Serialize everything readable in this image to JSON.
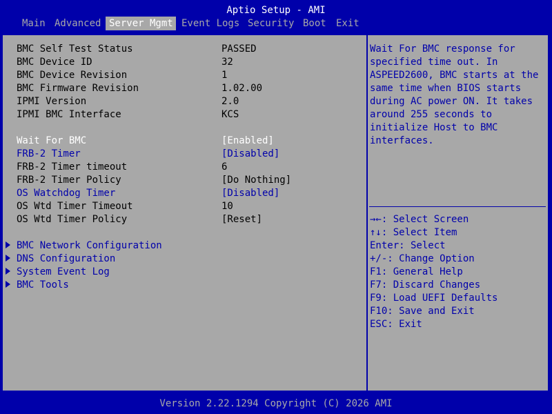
{
  "title": "Aptio Setup - AMI",
  "tabs": [
    {
      "label": "Main",
      "active": false
    },
    {
      "label": "Advanced",
      "active": false
    },
    {
      "label": "Server Mgmt",
      "active": true
    },
    {
      "label": "Event Logs",
      "active": false
    },
    {
      "label": "Security",
      "active": false
    },
    {
      "label": "Boot",
      "active": false
    },
    {
      "label": "Exit",
      "active": false
    }
  ],
  "info_rows": [
    {
      "label": "BMC Self Test Status",
      "value": "PASSED"
    },
    {
      "label": "BMC Device ID",
      "value": "32"
    },
    {
      "label": "BMC Device Revision",
      "value": "1"
    },
    {
      "label": "BMC Firmware Revision",
      "value": "1.02.00"
    },
    {
      "label": "IPMI Version",
      "value": "2.0"
    },
    {
      "label": "IPMI BMC Interface",
      "value": "KCS"
    }
  ],
  "settings": [
    {
      "label": "Wait For BMC",
      "value": "[Enabled]",
      "state": "selected"
    },
    {
      "label": "FRB-2 Timer",
      "value": "[Disabled]",
      "state": "editable"
    },
    {
      "label": "FRB-2 Timer timeout",
      "value": "6",
      "state": "static"
    },
    {
      "label": "FRB-2 Timer Policy",
      "value": "[Do Nothing]",
      "state": "static"
    },
    {
      "label": "OS Watchdog Timer",
      "value": "[Disabled]",
      "state": "editable"
    },
    {
      "label": "OS Wtd Timer Timeout",
      "value": "10",
      "state": "static"
    },
    {
      "label": "OS Wtd Timer Policy",
      "value": "[Reset]",
      "state": "static"
    }
  ],
  "submenus": [
    {
      "label": "BMC Network Configuration"
    },
    {
      "label": "DNS Configuration"
    },
    {
      "label": "System Event Log"
    },
    {
      "label": "BMC Tools"
    }
  ],
  "help_lines": [
    "Wait For BMC response for",
    "specified time out. In",
    "ASPEED2600, BMC starts at the",
    "same time when BIOS starts",
    "during AC power ON. It takes",
    "around 255 seconds to",
    "initialize Host to BMC",
    "interfaces."
  ],
  "key_lines": [
    "→←: Select Screen",
    "↑↓: Select Item",
    "Enter: Select",
    "+/-: Change Option",
    "F1: General Help",
    "F7: Discard Changes",
    "F9: Load UEFI Defaults",
    "F10: Save and Exit",
    "ESC: Exit"
  ],
  "footer": "Version 2.22.1294 Copyright (C) 2026 AMI",
  "colors": {
    "background": "#0000aa",
    "panel": "#a8a8a8",
    "selected_text": "#ffffff",
    "editable_text": "#0000aa",
    "static_text": "#000000"
  }
}
